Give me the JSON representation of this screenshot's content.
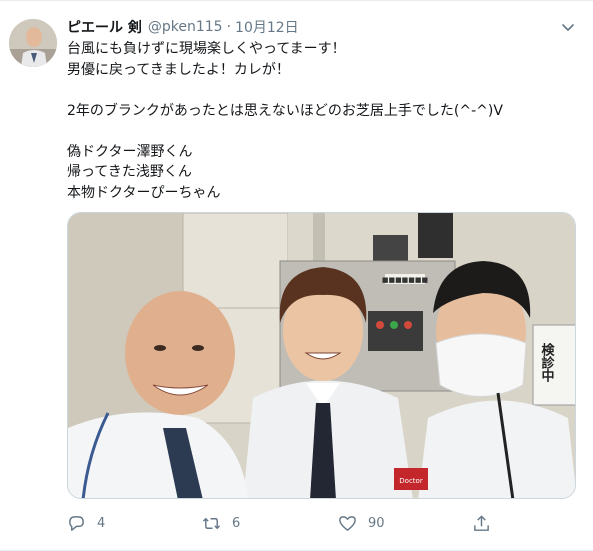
{
  "tweet": {
    "author_name": "ピエール 剣",
    "handle": "@pken115",
    "separator": "·",
    "date": "10月12日",
    "lines": [
      "台風にも負けずに現場楽しくやってまーす！",
      "男優に戻ってきましたよ！カレが！",
      "",
      "2年のブランクがあったとは思えないほどのお芝居上手でした(^-^)V",
      "",
      "偽ドクター澤野くん",
      "帰ってきた浅野くん",
      "本物ドクターぴーちゃん"
    ]
  },
  "photo": {
    "wall_sign": "検診中",
    "panel_label": "■■■■■■■",
    "badge_text": "Doctor"
  },
  "actions": {
    "reply_count": "4",
    "retweet_count": "6",
    "like_count": "90"
  },
  "icons": {
    "more": "chevron-down-icon",
    "reply": "reply-icon",
    "retweet": "retweet-icon",
    "like": "heart-icon",
    "share": "share-icon"
  },
  "colors": {
    "text": "#14171a",
    "secondary": "#657786",
    "border": "#e6ecf0"
  }
}
